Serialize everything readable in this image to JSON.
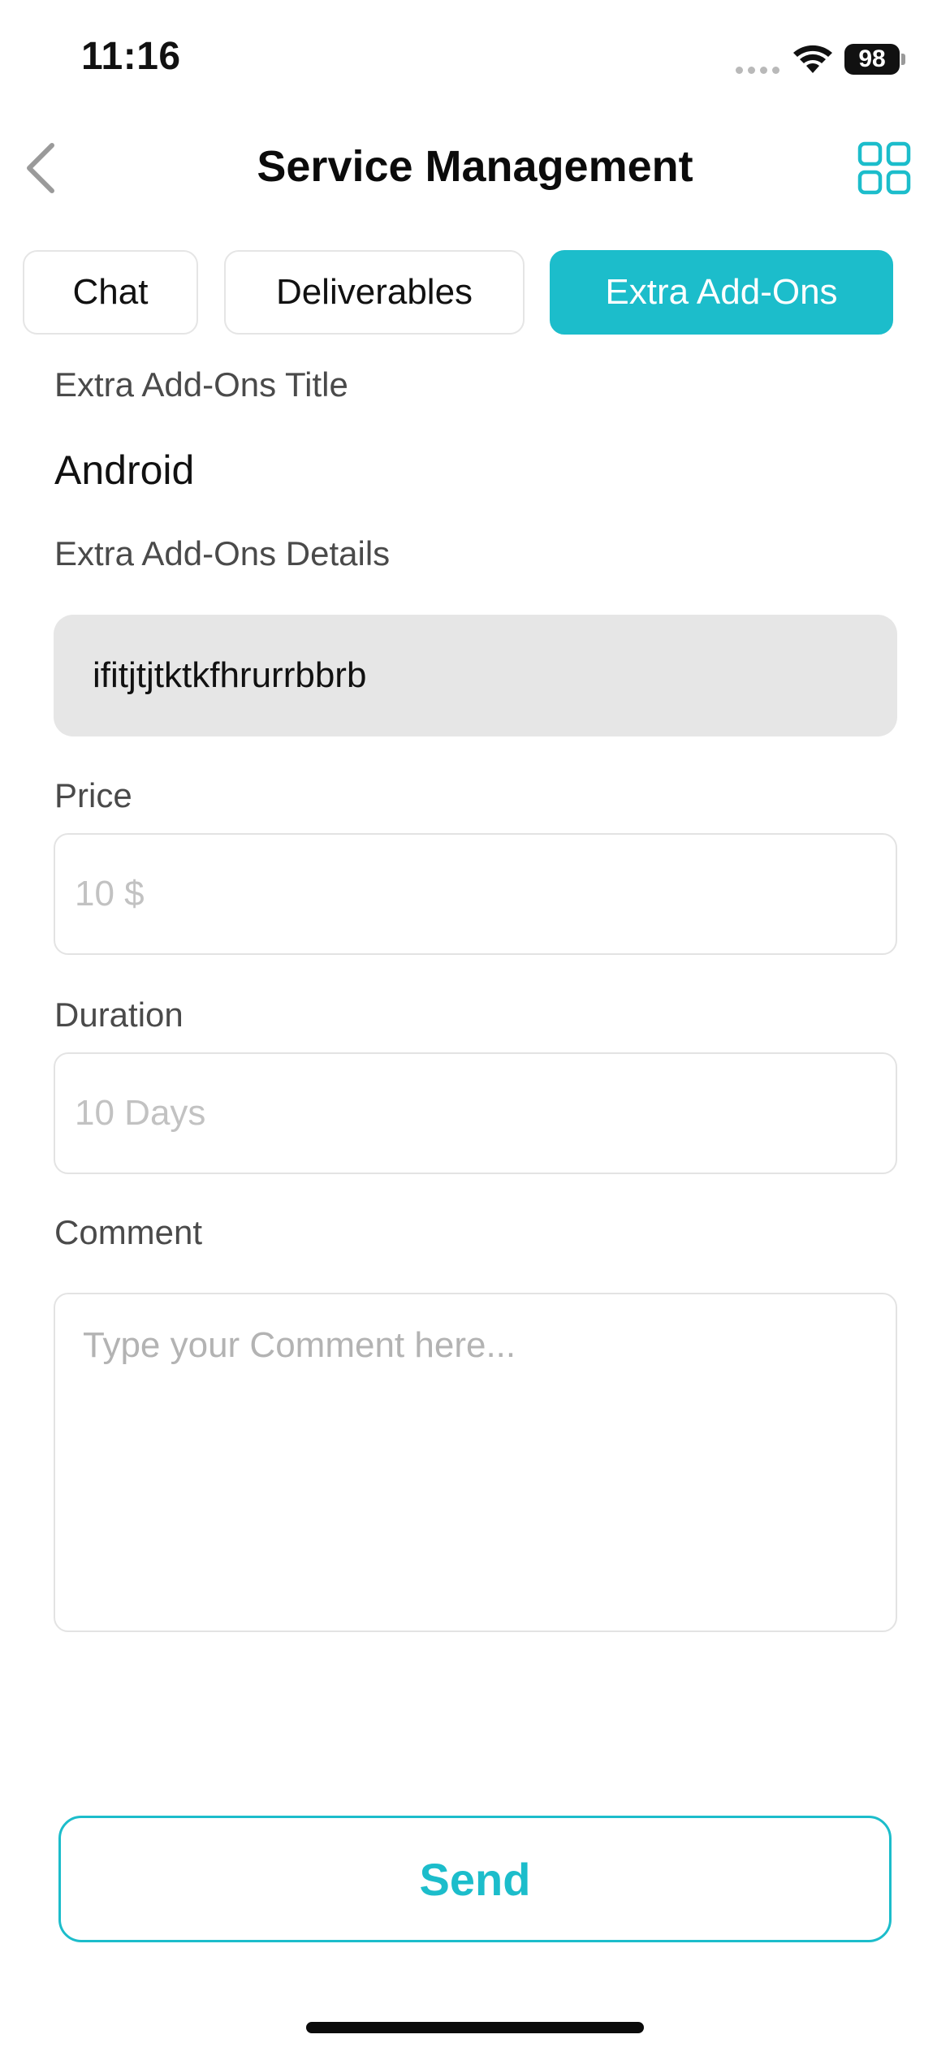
{
  "status_bar": {
    "time": "11:16",
    "battery": "98"
  },
  "header": {
    "title": "Service Management",
    "back_icon": "chevron-left-icon",
    "menu_icon": "grid-icon"
  },
  "tabs": [
    {
      "label": "Chat",
      "active": false
    },
    {
      "label": "Deliverables",
      "active": false
    },
    {
      "label": "Extra Add-Ons",
      "active": true
    }
  ],
  "form": {
    "title_label": "Extra Add-Ons Title",
    "title_value": "Android",
    "details_label": "Extra Add-Ons Details",
    "details_value": "ifitjtjtktkfhrurrbbrb",
    "price_label": "Price",
    "price_placeholder": "10 $",
    "duration_label": "Duration",
    "duration_placeholder": "10 Days",
    "comment_label": "Comment",
    "comment_placeholder": "Type your Comment here..."
  },
  "actions": {
    "send_label": "Send"
  },
  "colors": {
    "accent": "#1cbdcb",
    "details_bg": "#e6e6e6"
  }
}
